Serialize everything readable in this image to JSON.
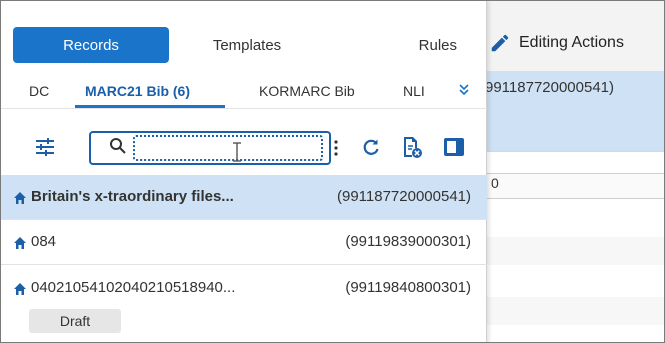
{
  "header": {
    "tabs": [
      {
        "label": "Records",
        "active": true
      },
      {
        "label": "Templates",
        "active": false
      },
      {
        "label": "Rules",
        "active": false
      }
    ],
    "editing_actions_label": "Editing Actions"
  },
  "profile_tabs": [
    {
      "label": "DC",
      "active": false
    },
    {
      "label": "MARC21 Bib (6)",
      "active": true
    },
    {
      "label": "KORMARC Bib",
      "active": false
    },
    {
      "label": "NLI",
      "active": false
    }
  ],
  "search": {
    "value": "",
    "placeholder": ""
  },
  "records": [
    {
      "title": "Britain's x-traordinary files...",
      "id": "(991187720000541)",
      "selected": true,
      "badge": ""
    },
    {
      "title": "084",
      "id": "(99119839000301)",
      "selected": false,
      "badge": ""
    },
    {
      "title": "04021054102040210518940...",
      "id": "(99119840800301)",
      "selected": false,
      "badge": "Draft"
    }
  ],
  "editor": {
    "record_id_fragment": "991187720000541)",
    "field_value": "0"
  },
  "colors": {
    "accent": "#1a74c9",
    "selected_row": "#cfe2f5",
    "active_text": "#1a5fa8"
  },
  "icons": [
    "filter-sliders-icon",
    "search-icon",
    "vertical-ellipsis-icon",
    "refresh-icon",
    "clear-document-icon",
    "panel-toggle-icon",
    "home-icon",
    "pencil-icon",
    "chevron-double-down-icon"
  ]
}
